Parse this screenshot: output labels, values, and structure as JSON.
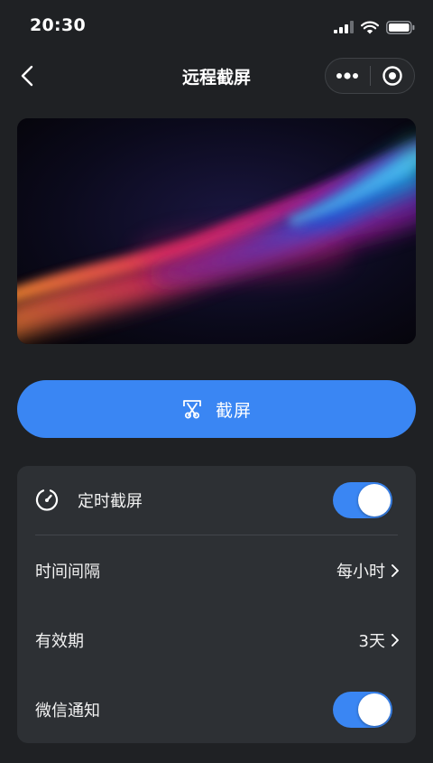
{
  "status_bar": {
    "time": "20:30"
  },
  "nav": {
    "title": "远程截屏"
  },
  "preview": {
    "icon": "wallpaper-image"
  },
  "capture_button": {
    "label": "截屏",
    "icon": "scissors-screenshot-icon"
  },
  "settings": {
    "scheduled_capture": {
      "label": "定时截屏",
      "icon": "timer-icon",
      "enabled": true
    },
    "interval": {
      "label": "时间间隔",
      "value": "每小时"
    },
    "validity": {
      "label": "有效期",
      "value": "3天"
    },
    "wechat_notify": {
      "label": "微信通知",
      "enabled": true
    }
  },
  "colors": {
    "background": "#1f2124",
    "card": "#2d3034",
    "accent": "#3a86f3"
  }
}
